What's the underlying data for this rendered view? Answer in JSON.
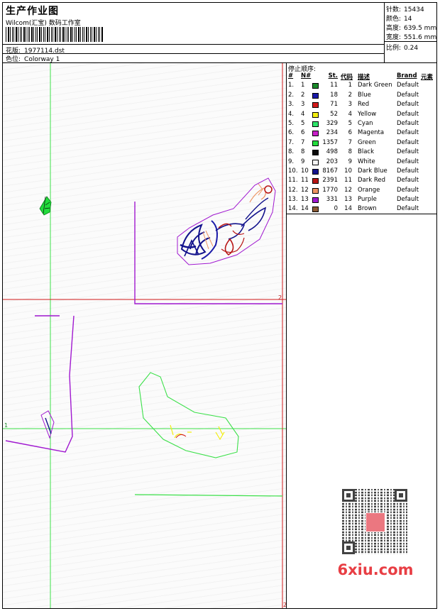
{
  "header": {
    "title": "生产作业图",
    "subtitle": "Wilcom(汇宝) 数码工作室",
    "design_label": "花版:",
    "design_value": "1977114.dst",
    "colorway_label": "色位:",
    "colorway_value": "Colorway 1"
  },
  "stats": {
    "stitches_label": "针数:",
    "stitches_value": "15434",
    "colors_label": "颜色:",
    "colors_value": "14",
    "height_label": "高度:",
    "height_value": "639.5 mm",
    "width_label": "宽度:",
    "width_value": "551.6 mm",
    "ratio_label": "比例:",
    "ratio_value": "0.24"
  },
  "sequence": {
    "title": "停止顺序:",
    "headers": {
      "num": "#",
      "nn": "N#",
      "st": "St.",
      "code": "代码",
      "desc": "描述",
      "brand": "Brand",
      "elem": "元素"
    },
    "rows": [
      {
        "num": "1.",
        "nn": "1",
        "color": "#1a8a2a",
        "st": "11",
        "code": "1",
        "desc": "Dark Green",
        "brand": "Default"
      },
      {
        "num": "2.",
        "nn": "2",
        "color": "#1a1aa8",
        "st": "18",
        "code": "2",
        "desc": "Blue",
        "brand": "Default"
      },
      {
        "num": "3.",
        "nn": "3",
        "color": "#d21a1a",
        "st": "71",
        "code": "3",
        "desc": "Red",
        "brand": "Default"
      },
      {
        "num": "4.",
        "nn": "4",
        "color": "#f2ee10",
        "st": "52",
        "code": "4",
        "desc": "Yellow",
        "brand": "Default"
      },
      {
        "num": "5.",
        "nn": "5",
        "color": "#2ee46a",
        "st": "329",
        "code": "5",
        "desc": "Cyan",
        "brand": "Default"
      },
      {
        "num": "6.",
        "nn": "6",
        "color": "#c81ec8",
        "st": "234",
        "code": "6",
        "desc": "Magenta",
        "brand": "Default"
      },
      {
        "num": "7.",
        "nn": "7",
        "color": "#22dc3c",
        "st": "1357",
        "code": "7",
        "desc": "Green",
        "brand": "Default"
      },
      {
        "num": "8.",
        "nn": "8",
        "color": "#0a0a0a",
        "st": "498",
        "code": "8",
        "desc": "Black",
        "brand": "Default"
      },
      {
        "num": "9.",
        "nn": "9",
        "color": "#f4f4f4",
        "st": "203",
        "code": "9",
        "desc": "White",
        "brand": "Default"
      },
      {
        "num": "10.",
        "nn": "10",
        "color": "#12128c",
        "st": "8167",
        "code": "10",
        "desc": "Dark Blue",
        "brand": "Default"
      },
      {
        "num": "11.",
        "nn": "11",
        "color": "#b81414",
        "st": "2391",
        "code": "11",
        "desc": "Dark Red",
        "brand": "Default"
      },
      {
        "num": "12.",
        "nn": "12",
        "color": "#ee9462",
        "st": "1770",
        "code": "12",
        "desc": "Orange",
        "brand": "Default"
      },
      {
        "num": "13.",
        "nn": "13",
        "color": "#a018d0",
        "st": "331",
        "code": "13",
        "desc": "Purple",
        "brand": "Default"
      },
      {
        "num": "14.",
        "nn": "14",
        "color": "#8a5a34",
        "st": "0",
        "code": "14",
        "desc": "Brown",
        "brand": "Default"
      }
    ]
  },
  "canvas": {
    "marker_1": "1",
    "marker_2": "2",
    "marker_2b": "2"
  },
  "watermark": {
    "text": "6xiu.com"
  }
}
